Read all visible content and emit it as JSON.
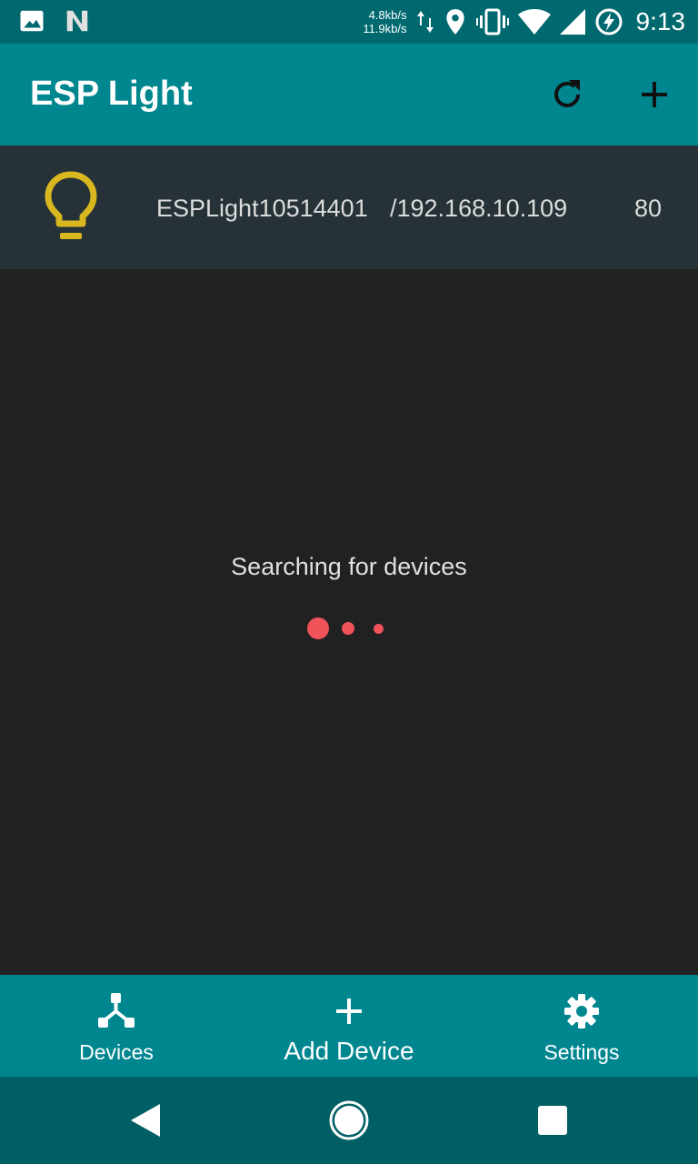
{
  "status_bar": {
    "upload_speed": "4.8kb/s",
    "download_speed": "11.9kb/s",
    "time": "9:13",
    "icons": [
      "image-icon",
      "n-icon",
      "data-arrows-icon",
      "location-icon",
      "vibrate-icon",
      "wifi-icon",
      "signal-icon",
      "battery-saver-icon"
    ]
  },
  "app_bar": {
    "title": "ESP Light",
    "actions": [
      "refresh-icon",
      "add-icon"
    ]
  },
  "devices": [
    {
      "name": "ESPLight10514401",
      "ip": "/192.168.10.109",
      "port": "80",
      "icon": "lightbulb-icon"
    }
  ],
  "status": {
    "searching_text": "Searching for devices"
  },
  "bottom_nav": {
    "items": [
      {
        "label": "Devices",
        "icon": "devices-icon"
      },
      {
        "label": "Add Device",
        "icon": "plus-icon"
      },
      {
        "label": "Settings",
        "icon": "gear-icon"
      }
    ]
  },
  "colors": {
    "status_bar": "#00696f",
    "primary": "#00868f",
    "device_row_bg": "#263238",
    "background": "#212121",
    "bulb": "#d9b71f",
    "loading_dots": "#f0535a",
    "system_nav": "#005f65"
  }
}
